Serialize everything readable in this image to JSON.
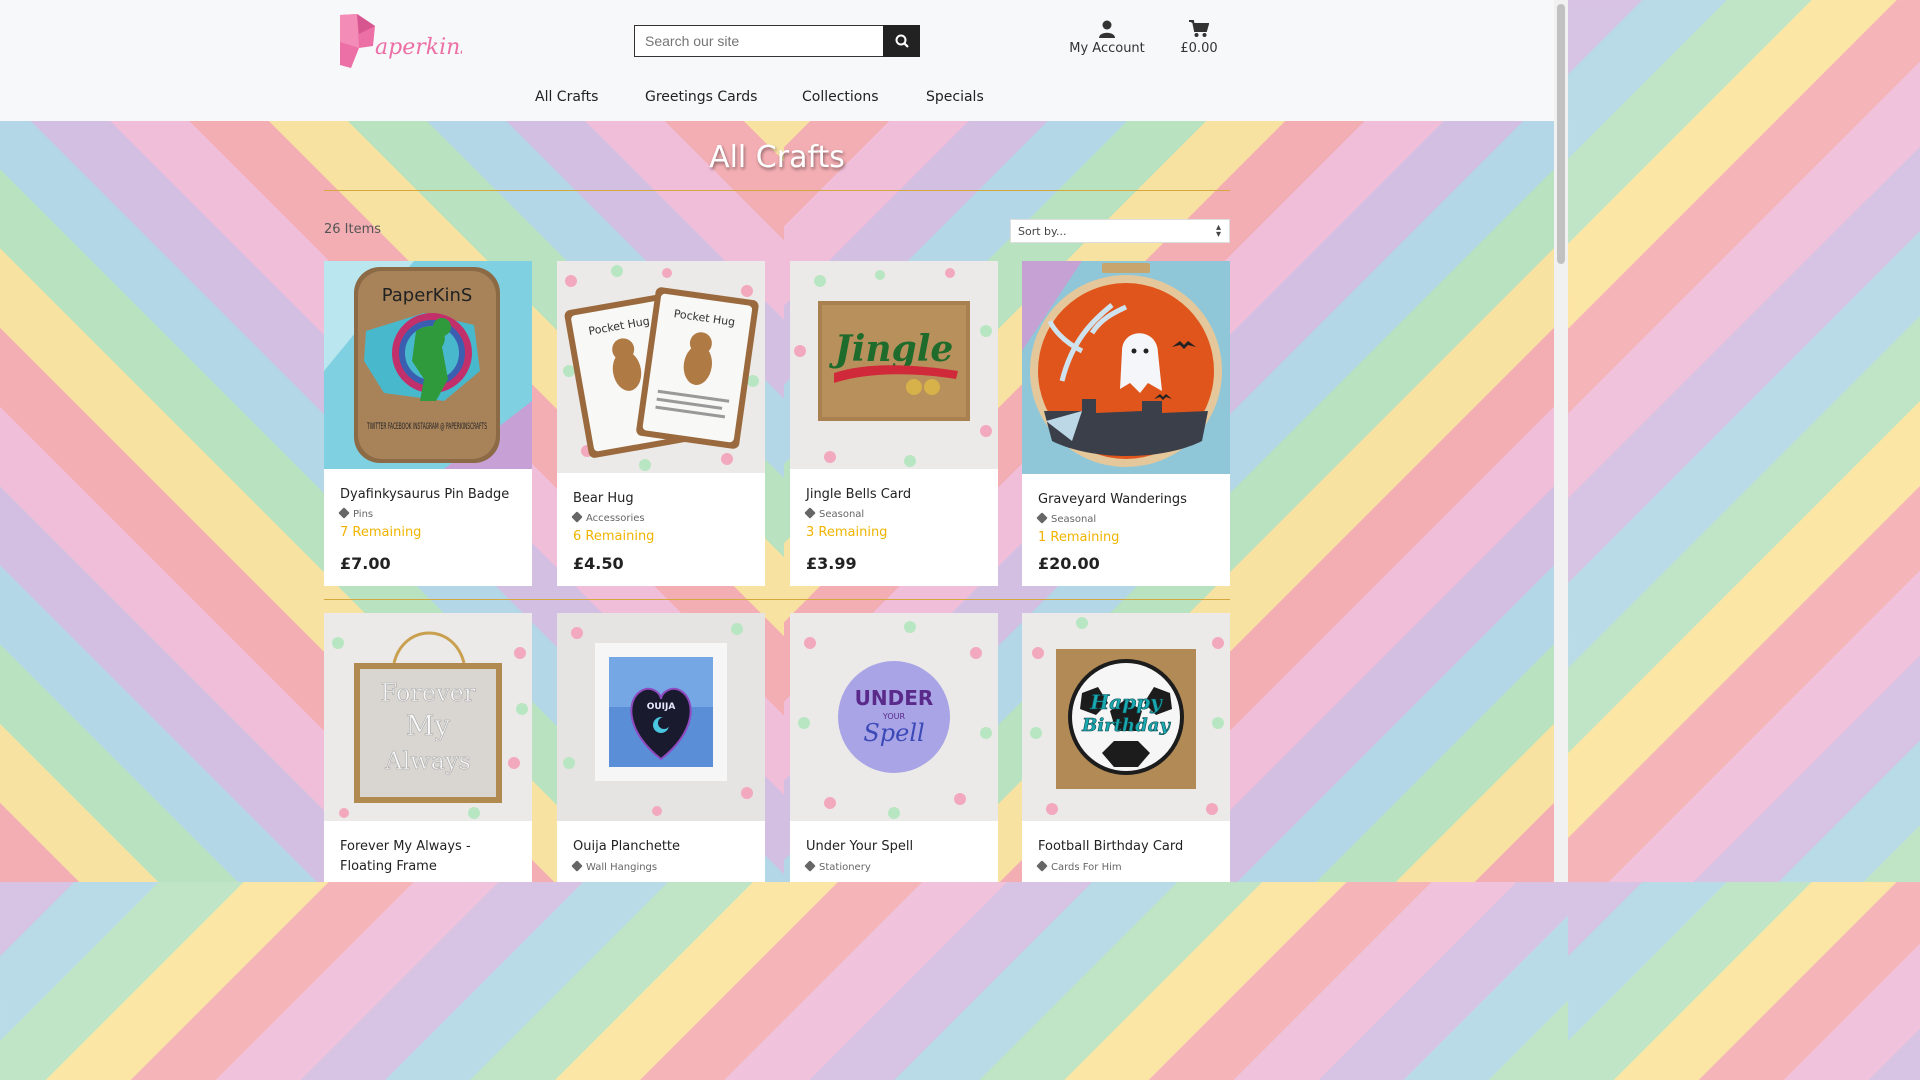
{
  "header": {
    "logo_text": "Paperkins",
    "search_placeholder": "Search our site",
    "account_label": "My Account",
    "cart_total": "£0.00"
  },
  "nav": [
    "All Crafts",
    "Greetings Cards",
    "Collections",
    "Specials"
  ],
  "main": {
    "title": "All Crafts",
    "item_count": "26 Items",
    "sort_label": "Sort by..."
  },
  "products": [
    {
      "name": "Dyafinkysaurus Pin Badge",
      "category": "Pins",
      "remaining": "7 Remaining",
      "price": "£7.00"
    },
    {
      "name": "Bear Hug",
      "category": "Accessories",
      "remaining": "6 Remaining",
      "price": "£4.50"
    },
    {
      "name": "Jingle Bells Card",
      "category": "Seasonal",
      "remaining": "3 Remaining",
      "price": "£3.99"
    },
    {
      "name": "Graveyard Wanderings",
      "category": "Seasonal",
      "remaining": "1 Remaining",
      "price": "£20.00"
    },
    {
      "name": "Forever My Always - Floating Frame",
      "category": "",
      "remaining": "",
      "price": ""
    },
    {
      "name": "Ouija Planchette",
      "category": "Wall Hangings",
      "remaining": "",
      "price": ""
    },
    {
      "name": "Under Your Spell",
      "category": "Stationery",
      "remaining": "",
      "price": ""
    },
    {
      "name": "Football Birthday Card",
      "category": "Cards For Him",
      "remaining": "",
      "price": ""
    }
  ],
  "image_text": {
    "badge_top": "PaperKinS",
    "badge_bottom": "TWITTER FACEBOOK INSTAGRAM @ PAPERKINSCRAFTS",
    "pocket_hug": "Pocket Hug",
    "jingle": "Jingle",
    "forever": "Forever",
    "my": "My",
    "always": "Always",
    "ouija": "OUIJA",
    "under": "UNDER",
    "your": "YOUR",
    "spell": "Spell",
    "happy": "Happy",
    "birthday": "Birthday"
  },
  "colors": {
    "accent": "#f0b400",
    "rule": "#d4a83c",
    "header_bg": "#f7f8f9",
    "logo_pink": "#ec6fa6"
  },
  "icons": {
    "search": "search-icon",
    "account": "user-icon",
    "cart": "cart-icon",
    "category": "tag-icon"
  }
}
